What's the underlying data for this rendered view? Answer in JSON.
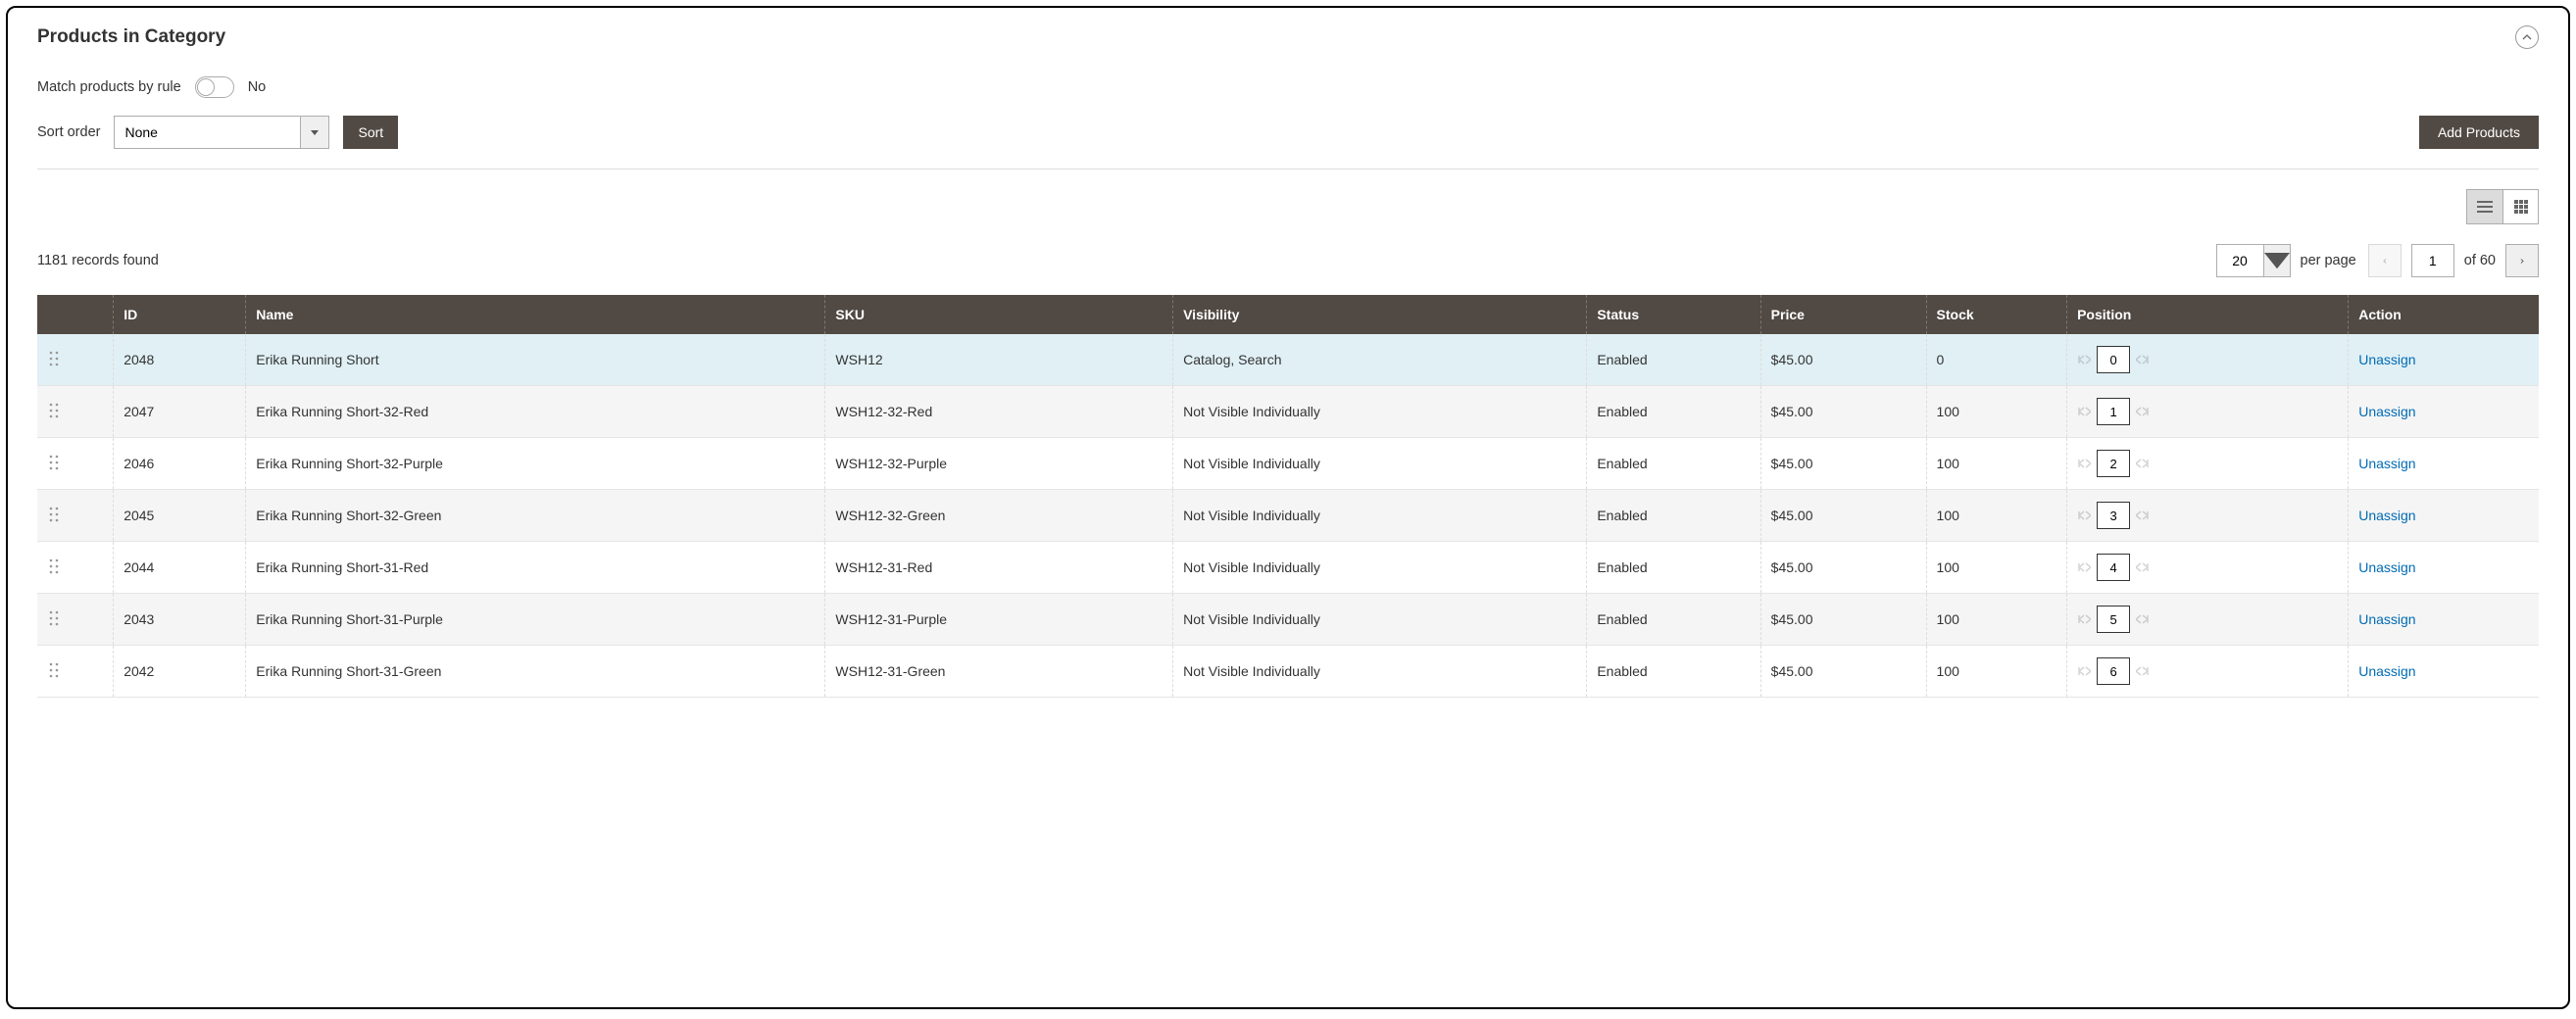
{
  "header": {
    "title": "Products in Category"
  },
  "matchRule": {
    "label": "Match products by rule",
    "value_text": "No"
  },
  "sortOrder": {
    "label": "Sort order",
    "selected": "None",
    "sort_button": "Sort"
  },
  "addProducts": {
    "label": "Add Products"
  },
  "toolbar": {
    "records_text": "1181 records found",
    "per_page_value": "20",
    "per_page_label": "per page",
    "current_page": "1",
    "total_pages_text": "of 60"
  },
  "columns": {
    "id": "ID",
    "name": "Name",
    "sku": "SKU",
    "visibility": "Visibility",
    "status": "Status",
    "price": "Price",
    "stock": "Stock",
    "position": "Position",
    "action": "Action"
  },
  "action_label": "Unassign",
  "rows": [
    {
      "id": "2048",
      "name": "Erika Running Short",
      "sku": "WSH12",
      "visibility": "Catalog, Search",
      "status": "Enabled",
      "price": "$45.00",
      "stock": "0",
      "position": "0",
      "highlighted": true
    },
    {
      "id": "2047",
      "name": "Erika Running Short-32-Red",
      "sku": "WSH12-32-Red",
      "visibility": "Not Visible Individually",
      "status": "Enabled",
      "price": "$45.00",
      "stock": "100",
      "position": "1"
    },
    {
      "id": "2046",
      "name": "Erika Running Short-32-Purple",
      "sku": "WSH12-32-Purple",
      "visibility": "Not Visible Individually",
      "status": "Enabled",
      "price": "$45.00",
      "stock": "100",
      "position": "2"
    },
    {
      "id": "2045",
      "name": "Erika Running Short-32-Green",
      "sku": "WSH12-32-Green",
      "visibility": "Not Visible Individually",
      "status": "Enabled",
      "price": "$45.00",
      "stock": "100",
      "position": "3"
    },
    {
      "id": "2044",
      "name": "Erika Running Short-31-Red",
      "sku": "WSH12-31-Red",
      "visibility": "Not Visible Individually",
      "status": "Enabled",
      "price": "$45.00",
      "stock": "100",
      "position": "4"
    },
    {
      "id": "2043",
      "name": "Erika Running Short-31-Purple",
      "sku": "WSH12-31-Purple",
      "visibility": "Not Visible Individually",
      "status": "Enabled",
      "price": "$45.00",
      "stock": "100",
      "position": "5"
    },
    {
      "id": "2042",
      "name": "Erika Running Short-31-Green",
      "sku": "WSH12-31-Green",
      "visibility": "Not Visible Individually",
      "status": "Enabled",
      "price": "$45.00",
      "stock": "100",
      "position": "6"
    }
  ]
}
